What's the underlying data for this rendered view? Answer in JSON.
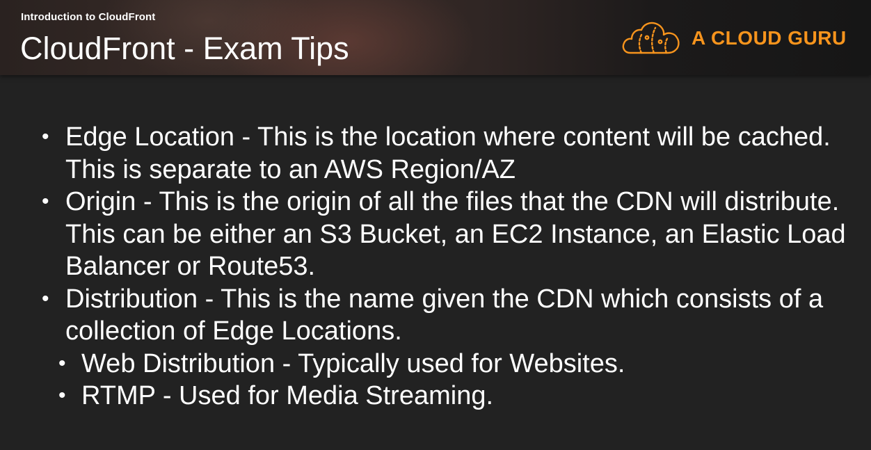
{
  "header": {
    "subtitle": "Introduction to CloudFront",
    "title": "CloudFront - Exam Tips",
    "logo_text": "A CLOUD GURU",
    "logo_icon": "cloud-icon",
    "accent_color": "#F7941D"
  },
  "bullets": [
    {
      "text": "Edge Location - This is the location where content will be cached. This is separate to an AWS Region/AZ"
    },
    {
      "text": "Origin - This is the origin of all the files that the CDN will distribute. This can be either an S3 Bucket, an EC2 Instance, an Elastic Load Balancer or Route53."
    },
    {
      "text": "Distribution - This is the name given the CDN which consists of a collection of Edge Locations."
    }
  ],
  "sub_bullets": [
    {
      "text": "Web Distribution - Typically used for Websites."
    },
    {
      "text": "RTMP - Used for Media Streaming."
    }
  ],
  "bullet_glyph": "•"
}
